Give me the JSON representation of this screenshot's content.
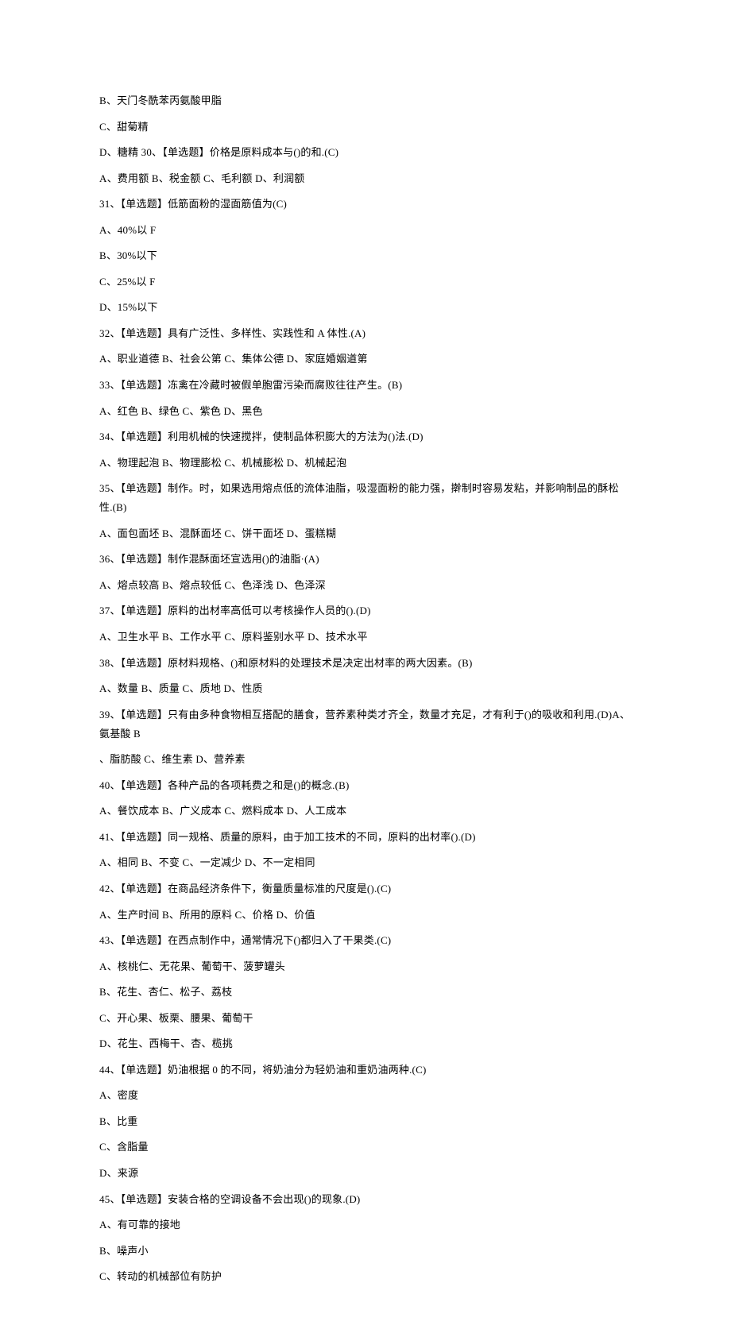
{
  "lines": [
    "B、天门冬酰苯丙氨酸甲脂",
    "C、甜菊精",
    "D、糖精 30、【单选题】价格是原料成本与()的和.(C)",
    "A、费用额 B、税金额 C、毛利额 D、利润额",
    "31、【单选题】低筋面粉的湿面筋值为(C)",
    "A、40%以 F",
    "B、30%以下",
    "C、25%以 F",
    "D、15%以下",
    "32、【单选题】具有广泛性、多样性、实践性和 A 体性.(A)",
    "A、职业道德 B、社会公第 C、集体公德 D、家庭婚姻道第",
    "33、【单选题】冻禽在冷藏时被假单胞雷污染而腐败往往产生。(B)",
    "A、红色 B、绿色 C、紫色 D、黑色",
    "34、【单选题】利用机械的快速搅拌，使制品体积膨大的方法为()法.(D)",
    "A、物理起泡 B、物理膨松 C、机械膨松 D、机械起泡",
    "35、【单选题】制作。时，如果选用熔点低的流体油脂，吸湿面粉的能力强，擀制时容易发粘，并影响制品的酥松性.(B)",
    "A、面包面坯 B、混酥面坯 C、饼干面坯 D、蛋糕糊",
    "36、【单选题】制作混酥面坯宣选用()的油脂·(A)",
    "A、熔点较高 B、熔点较低 C、色泽浅 D、色泽深",
    "37、【单选题】原料的出材率高低可以考核操作人员的().(D)",
    "A、卫生水平 B、工作水平 C、原料鉴别水平 D、技术水平",
    "38、【单选题】原材料规格、()和原材料的处理技术是决定出材率的两大因素。(B)",
    "A、数量 B、质量 C、质地 D、性质",
    "39、【单选题】只有由多种食物相互搭配的膳食，营养素种类才齐全，数量才充足，才有利于()的吸收和利用.(D)A、氨基酸 B",
    "、脂肪酸 C、维生素 D、营养素",
    "40、【单选题】各种产品的各项耗费之和是()的概念.(B)",
    "A、餐饮成本 B、广义成本 C、燃料成本 D、人工成本",
    "41、【单选题】同一规格、质量的原料，由于加工技术的不同，原料的出材率().(D)",
    "A、相同 B、不变 C、一定减少 D、不一定相同",
    "42、【单选题】在商品经济条件下，衡量质量标准的尺度是().(C)",
    "A、生产时间 B、所用的原料 C、价格 D、价值",
    "43、【单选题】在西点制作中，通常情况下()都归入了干果类.(C)",
    "A、核桃仁、无花果、葡萄干、菠萝罐头",
    "B、花生、杏仁、松子、荔枝",
    "C、开心果、板栗、腰果、葡萄干",
    "D、花生、西梅干、杏、榄挑",
    "44、【单选题】奶油根据 0 的不同，将奶油分为轻奶油和重奶油两种.(C)",
    "A、密度",
    "B、比重",
    "C、含脂量",
    "D、来源",
    "45、【单选题】安装合格的空调设备不会出现()的现象.(D)",
    "A、有可靠的接地",
    "B、噪声小",
    "C、转动的机械部位有防护"
  ]
}
